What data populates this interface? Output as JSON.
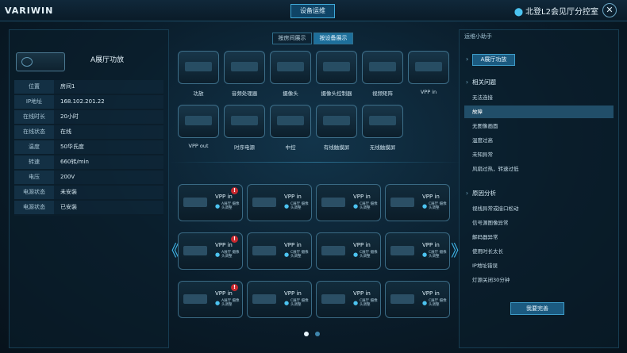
{
  "header": {
    "logo": "VARIWIN",
    "button": "设备运维",
    "location": "北登L2会见厅分控室"
  },
  "left": {
    "title": "A展厅功放",
    "rows": [
      {
        "k": "位置",
        "v": "房间1"
      },
      {
        "k": "IP地址",
        "v": "168.102.201.22"
      },
      {
        "k": "在线时长",
        "v": "20小时"
      },
      {
        "k": "在线状态",
        "v": "在线"
      },
      {
        "k": "温度",
        "v": "50华氏度"
      },
      {
        "k": "转速",
        "v": "660转/min"
      },
      {
        "k": "电压",
        "v": "200V"
      },
      {
        "k": "电源状态",
        "v": "未安装"
      },
      {
        "k": "电源状态",
        "v": "已安装"
      }
    ]
  },
  "middle": {
    "toggle": [
      "按房间展示",
      "按设备展示"
    ],
    "devices": [
      "功放",
      "音频处理器",
      "摄像头",
      "摄像头控制器",
      "视频矩阵",
      "VPP in",
      "VPP out",
      "时序电源",
      "中控",
      "有线触摸屏",
      "无线触摸屏"
    ],
    "cards": [
      {
        "title": "VPP in",
        "sub": "A展厅 摄像头调整",
        "alert": true
      },
      {
        "title": "VPP in",
        "sub": "C展厅 摄像头调整",
        "alert": false
      },
      {
        "title": "VPP in",
        "sub": "C展厅 摄像头调整",
        "alert": false
      },
      {
        "title": "VPP in",
        "sub": "C展厅 摄像头调整",
        "alert": false
      },
      {
        "title": "VPP in",
        "sub": "A展厅 摄像头调整",
        "alert": true
      },
      {
        "title": "VPP in",
        "sub": "C展厅 摄像头调整",
        "alert": false
      },
      {
        "title": "VPP in",
        "sub": "C展厅 摄像头调整",
        "alert": false
      },
      {
        "title": "VPP in",
        "sub": "C展厅 摄像头调整",
        "alert": false
      },
      {
        "title": "VPP in",
        "sub": "A展厅 摄像头调整",
        "alert": true
      },
      {
        "title": "VPP in",
        "sub": "C展厅 摄像头调整",
        "alert": false
      },
      {
        "title": "VPP in",
        "sub": "C展厅 摄像头调整",
        "alert": false
      },
      {
        "title": "VPP in",
        "sub": "C展厅 摄像头调整",
        "alert": false
      }
    ],
    "arrows": {
      "left": "《",
      "right": "》"
    }
  },
  "right": {
    "head": "运维小助手",
    "badge": "A展厅功放",
    "sec1": "相关问题",
    "issues": [
      "无法连接",
      "故障",
      "无图像画面",
      "温度过高",
      "未知异常",
      "风扇过热，转速过低"
    ],
    "sec2": "原因分析",
    "causes": [
      "视线异常或接口松动",
      "信号源图像异常",
      "解码器异常",
      "使用时长太长",
      "IP地址错误",
      "灯源关闭30分钟"
    ],
    "button": "我要完善"
  },
  "alert_glyph": "!",
  "colors": {
    "accent": "#3fb3e6",
    "alert": "#c8282e",
    "selected": "#214e69"
  }
}
